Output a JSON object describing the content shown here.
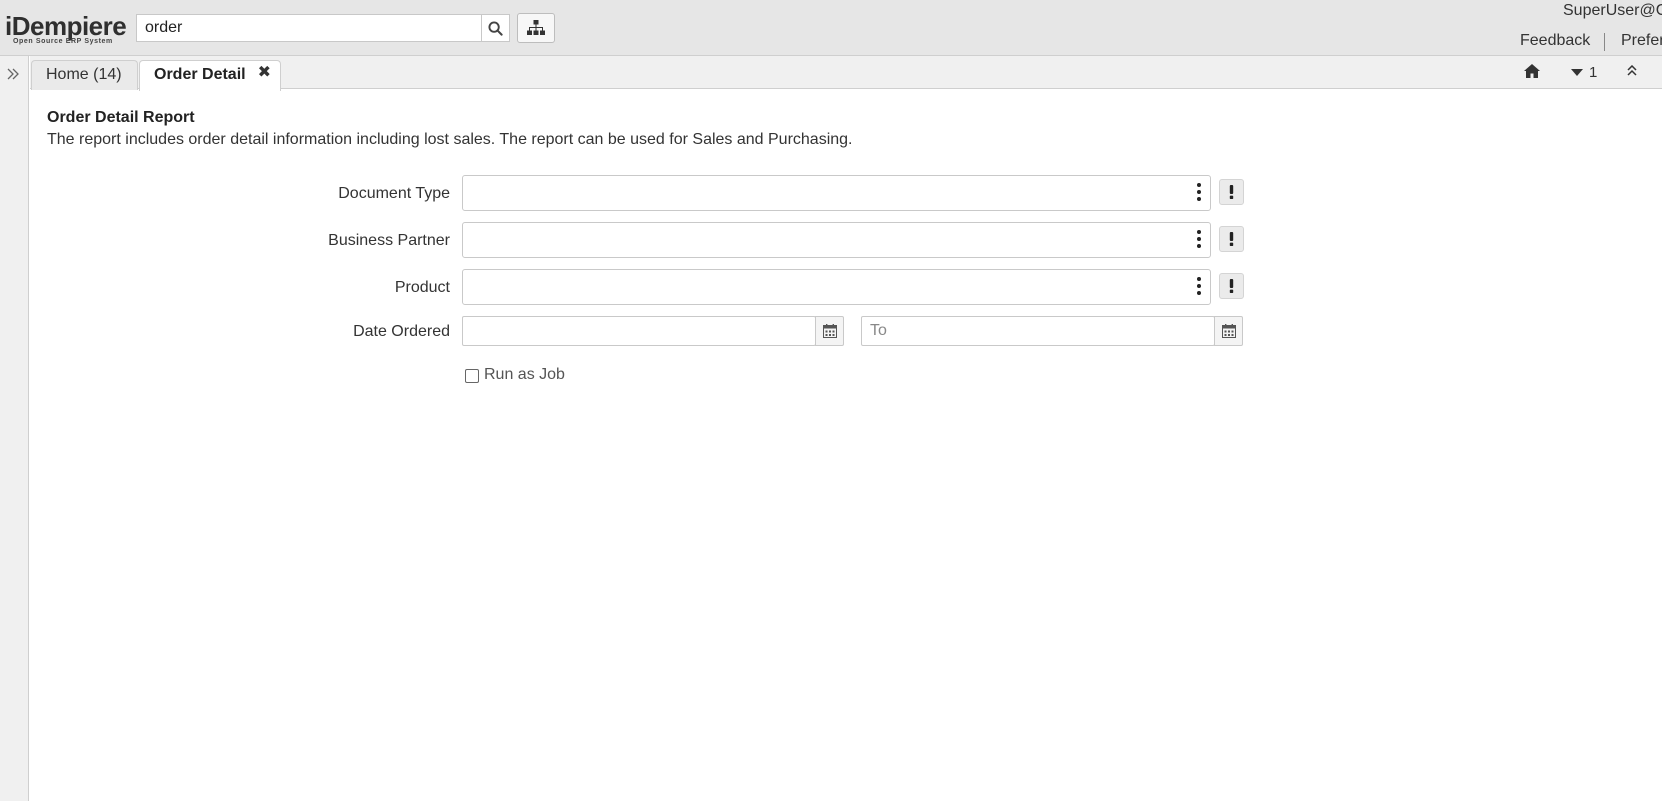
{
  "app": {
    "logo_text": "iDempiere",
    "logo_tagline": "Open Source ERP System"
  },
  "header": {
    "search_value": "order",
    "user": "SuperUser@G",
    "feedback_label": "Feedback",
    "preferences_label": "Prefer"
  },
  "tabs": [
    {
      "label": "Home (14)",
      "active": false
    },
    {
      "label": "Order Detail",
      "active": true
    }
  ],
  "tabbar": {
    "window_count": "1"
  },
  "report": {
    "title": "Order Detail Report",
    "description": "The report includes order detail information including lost sales. The report can be used for Sales and Purchasing."
  },
  "fields": {
    "document_type": {
      "label": "Document Type",
      "value": ""
    },
    "business_partner": {
      "label": "Business Partner",
      "value": ""
    },
    "product": {
      "label": "Product",
      "value": ""
    },
    "date_ordered": {
      "label": "Date Ordered",
      "from_value": "",
      "to_placeholder": "To"
    }
  },
  "run_as_job": {
    "label": "Run as Job",
    "checked": false
  },
  "icons": [
    "search-icon",
    "menu-tree-icon",
    "expand-icon",
    "close-icon",
    "home-icon",
    "caret-down-icon",
    "collapse-up-icon",
    "kebab-icon",
    "exclamation-icon",
    "calendar-icon"
  ],
  "colors": {
    "header_bg": "#e6e6e6",
    "tabbar_bg": "#f0f0f0"
  }
}
